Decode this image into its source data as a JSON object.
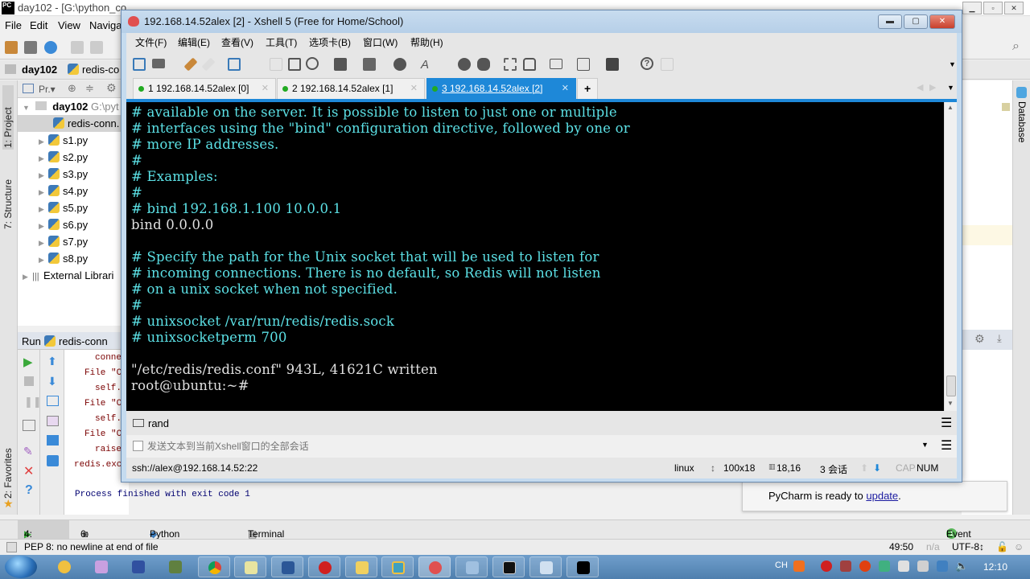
{
  "pycharm": {
    "title": "day102 - [G:\\python_co",
    "logo": "PC",
    "menu": [
      "File",
      "Edit",
      "View",
      "Naviga"
    ],
    "nav": {
      "project": "day102",
      "file": "redis-co"
    },
    "project_header": "Pr.▾",
    "tree": {
      "root": "day102",
      "root_path": "G:\\pyt",
      "items": [
        "redis-conn.",
        "s1.py",
        "s2.py",
        "s3.py",
        "s4.py",
        "s5.py",
        "s6.py",
        "s7.py",
        "s8.py"
      ],
      "external": "External Librari"
    },
    "left_tabs": {
      "project": "1: Project",
      "structure": "7: Structure",
      "favorites": "2: Favorites"
    },
    "right_tabs": {
      "database": "Database"
    },
    "run": {
      "label": "Run",
      "config": "redis-conn",
      "output": [
        "conne",
        "File \"C",
        "self.",
        "File \"C",
        "self.",
        "File \"C",
        "raise",
        "redis.exc"
      ],
      "process": "Process finished with exit code 1"
    },
    "bottom_tabs": [
      "4: Run",
      "6: TODO",
      "Python Console",
      "Terminal"
    ],
    "event_log": {
      "count": "1",
      "label": "Event Log"
    },
    "status": {
      "message": "PEP 8: no newline at end of file",
      "position": "49:50",
      "na": "n/a",
      "encoding": "UTF-8↕"
    },
    "notification": {
      "text": "PyCharm is ready to ",
      "link": "update",
      "suffix": "."
    }
  },
  "xshell": {
    "title": "192.168.14.52alex [2] - Xshell 5 (Free for Home/School)",
    "menu": [
      "文件(F)",
      "编辑(E)",
      "查看(V)",
      "工具(T)",
      "选项卡(B)",
      "窗口(W)",
      "帮助(H)"
    ],
    "tabs": [
      {
        "label": "1 192.168.14.52alex [0]",
        "active": false
      },
      {
        "label": "2 192.168.14.52alex [1]",
        "active": false
      },
      {
        "label": "3 192.168.14.52alex [2]",
        "active": true
      }
    ],
    "add_tab": "+",
    "terminal_lines": [
      {
        "text": "# available on the server. It is possible to listen to just one or multiple",
        "color": "c"
      },
      {
        "text": "# interfaces using the \"bind\" configuration directive, followed by one or",
        "color": "c"
      },
      {
        "text": "# more IP addresses.",
        "color": "c"
      },
      {
        "text": "#",
        "color": "c"
      },
      {
        "text": "# Examples:",
        "color": "c"
      },
      {
        "text": "#",
        "color": "c"
      },
      {
        "text": "# bind 192.168.1.100 10.0.0.1",
        "color": "c"
      },
      {
        "text": "bind 0.0.0.0",
        "color": "w"
      },
      {
        "text": "",
        "color": "w"
      },
      {
        "text": "# Specify the path for the Unix socket that will be used to listen for",
        "color": "c"
      },
      {
        "text": "# incoming connections. There is no default, so Redis will not listen",
        "color": "c"
      },
      {
        "text": "# on a unix socket when not specified.",
        "color": "c"
      },
      {
        "text": "#",
        "color": "c"
      },
      {
        "text": "# unixsocket /var/run/redis/redis.sock",
        "color": "c"
      },
      {
        "text": "# unixsocketperm 700",
        "color": "c"
      },
      {
        "text": "",
        "color": "w"
      },
      {
        "text": "\"/etc/redis/redis.conf\" 943L, 41621C written",
        "color": "w"
      },
      {
        "text": "root@ubuntu:~#",
        "color": "w"
      }
    ],
    "compose_label": "rand",
    "send_placeholder": "发送文本到当前Xshell窗口的全部会话",
    "status": {
      "connection": "ssh://alex@192.168.14.52:22",
      "term": "linux",
      "size": "100x18",
      "cursor": "18,16",
      "sessions": "3 会话",
      "cap": "CAP",
      "num": "NUM"
    }
  },
  "taskbar": {
    "ime": "CH",
    "clock": "12:10"
  },
  "colors": {
    "accent": "#1e88d8",
    "terminal_cyan": "#5ce1e6",
    "terminal_bg": "#000000"
  }
}
